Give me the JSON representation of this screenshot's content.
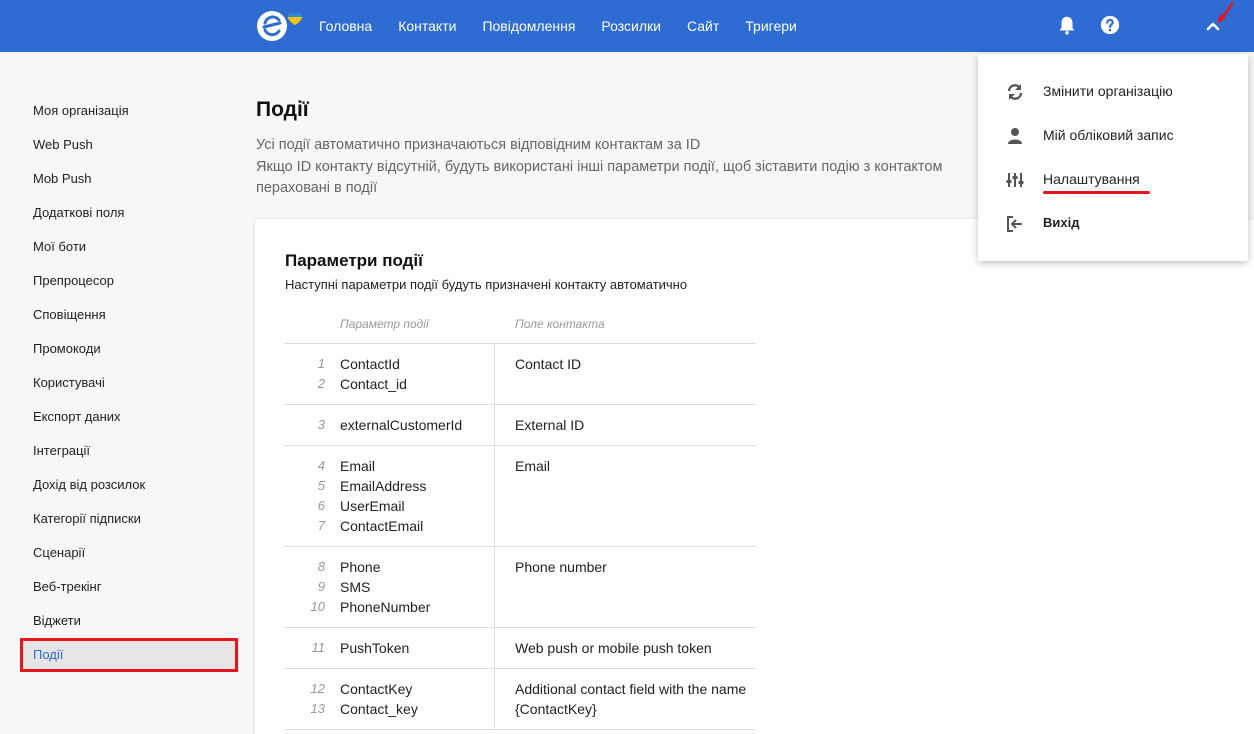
{
  "nav": {
    "items": [
      "Головна",
      "Контакти",
      "Повідомлення",
      "Розсилки",
      "Сайт",
      "Тригери"
    ]
  },
  "icons": {
    "logo": "esputnik-logo",
    "bell": "bell-icon",
    "help": "help-icon",
    "chevron": "chevron-up-icon"
  },
  "colors": {
    "brand": "#2e6bd3",
    "highlight": "#e8141c"
  },
  "sidebar": {
    "items": [
      "Моя організація",
      "Web Push",
      "Mob Push",
      "Додаткові поля",
      "Мої боти",
      "Препроцесор",
      "Сповіщення",
      "Промокоди",
      "Користувачі",
      "Експорт даних",
      "Інтеграції",
      "Дохід від розсилок",
      "Категорії підписки",
      "Сценарії",
      "Веб-трекінг",
      "Віджети",
      "Події"
    ],
    "active": "Події"
  },
  "page": {
    "title": "Події",
    "desc_lines": [
      "Усі події автоматично призначаються відповідним контактам за ID",
      "Якщо ID контакту відсутній, будуть використані інші параметри події, щоб зіставити подію з контактом",
      "пераховані в події"
    ]
  },
  "card": {
    "title": "Параметри події",
    "subtitle": "Наступні параметри події будуть призначені контакту автоматично",
    "col_param": "Параметр події",
    "col_field": "Поле контакта",
    "groups": [
      {
        "params": [
          {
            "n": "1",
            "name": "ContactId"
          },
          {
            "n": "2",
            "name": "Contact_id"
          }
        ],
        "field": "Contact ID"
      },
      {
        "params": [
          {
            "n": "3",
            "name": "externalCustomerId"
          }
        ],
        "field": "External ID"
      },
      {
        "params": [
          {
            "n": "4",
            "name": "Email"
          },
          {
            "n": "5",
            "name": "EmailAddress"
          },
          {
            "n": "6",
            "name": "UserEmail"
          },
          {
            "n": "7",
            "name": "ContactEmail"
          }
        ],
        "field": "Email"
      },
      {
        "params": [
          {
            "n": "8",
            "name": "Phone"
          },
          {
            "n": "9",
            "name": "SMS"
          },
          {
            "n": "10",
            "name": "PhoneNumber"
          }
        ],
        "field": "Phone number"
      },
      {
        "params": [
          {
            "n": "11",
            "name": "PushToken"
          }
        ],
        "field": "Web push or mobile push token"
      },
      {
        "params": [
          {
            "n": "12",
            "name": "ContactKey"
          },
          {
            "n": "13",
            "name": "Contact_key"
          }
        ],
        "field": "Additional contact field with the name {ContactKey}"
      }
    ]
  },
  "dropdown": {
    "items": [
      {
        "label": "Змінити організацію",
        "icon": "refresh-icon"
      },
      {
        "label": "Мій обліковий запис",
        "icon": "user-icon"
      },
      {
        "label": "Налаштування",
        "icon": "sliders-icon"
      },
      {
        "label": "Вихід",
        "icon": "logout-icon"
      }
    ]
  }
}
